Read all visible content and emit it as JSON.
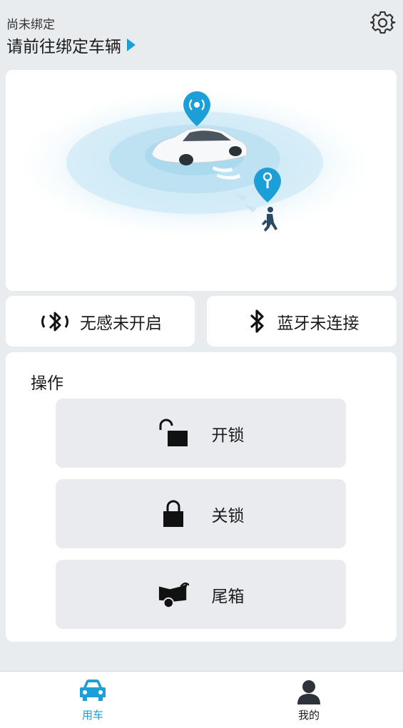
{
  "header": {
    "status": "尚未绑定",
    "bind_prompt": "请前往绑定车辆",
    "settings_icon": "gear-icon"
  },
  "hero": {
    "car_pin_icon": "signal-pin-icon",
    "key_pin_icon": "key-pin-icon"
  },
  "chips": {
    "sensorless": {
      "label": "无感未开启",
      "icon": "bluetooth-proximity-icon"
    },
    "bluetooth": {
      "label": "蓝牙未连接",
      "icon": "bluetooth-icon"
    }
  },
  "operations": {
    "title": "操作",
    "unlock": {
      "label": "开锁",
      "icon": "unlock-icon"
    },
    "lock": {
      "label": "关锁",
      "icon": "lock-icon"
    },
    "trunk": {
      "label": "尾箱",
      "icon": "trunk-icon"
    }
  },
  "tabbar": {
    "car": {
      "label": "用车",
      "icon": "car-icon",
      "active": true
    },
    "mine": {
      "label": "我的",
      "icon": "user-icon",
      "active": false
    }
  },
  "colors": {
    "accent": "#1c9fd6",
    "background": "#e9ecef",
    "button": "#e9ebee"
  }
}
